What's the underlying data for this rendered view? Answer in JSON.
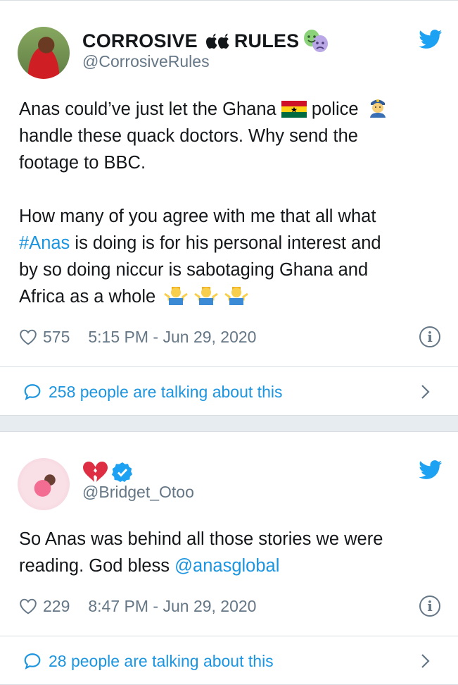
{
  "tweets": [
    {
      "display_name": "CORROSIVE",
      "display_name_suffix": "RULES",
      "handle": "@CorrosiveRules",
      "text": {
        "line1_a": "Anas could’ve just let the Ghana",
        "line1_b": "police",
        "line2": "handle these quack doctors. Why send the",
        "line3": "footage to BBC.",
        "p2_a": "How many of you agree with me that all what",
        "hashtag": "#Anas",
        "p2_b": "is doing  is for his personal interest and",
        "p2_c": "by so doing niccur is sabotaging Ghana and",
        "p2_d": "Africa as a whole"
      },
      "likes": "575",
      "timestamp": "5:15 PM - Jun 29, 2020",
      "talking": "258 people are talking about this"
    },
    {
      "handle": "@Bridget_Otoo",
      "text": {
        "line1": "So Anas was behind all those stories we were",
        "line2_a": "reading. God bless",
        "mention": "@anasglobal"
      },
      "likes": "229",
      "timestamp": "8:47 PM - Jun 29, 2020",
      "talking": "28 people are talking about this"
    }
  ],
  "icons": {
    "bird": "twitter-bird-icon",
    "heart": "heart-icon",
    "info": "info-icon",
    "bubble": "comment-bubble-icon",
    "chevron": "chevron-right-icon"
  },
  "colors": {
    "link": "#1b95e0",
    "muted": "#657786",
    "background": "#e6ecf0"
  }
}
